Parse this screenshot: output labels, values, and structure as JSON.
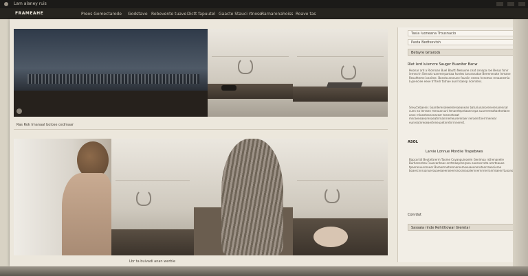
{
  "window": {
    "title": "Lam alaney ruis"
  },
  "nav": {
    "logo": "FRAMEAHE",
    "items": [
      "Preos Gomectarode",
      "Godstave",
      "Rebevente tuave",
      "Dictt fapuutel",
      "Gaacte Stauci rtnose",
      "Rarnaronahoiss",
      "Roave tas"
    ]
  },
  "captions": {
    "top": "Ras   Rok Imanaal bolose cedmaar",
    "bottom": "Lbr ta buivadi anan werble"
  },
  "sidebar": {
    "search": "Tasia luoneana Trousnacio",
    "filter": "Pasta Bedtesvtsh",
    "section": "Betsyre Grtarods",
    "para_heading": "Rlet lerd luismcre Sauger Buaniter Banw",
    "para1": "Hoonar ard a Rionroan Buel Bautti Nesuone ceat cenapa roe Besus fonir iernecrin Sennat raanmerpantaa hontes taruranatae Bremnenate Inmane Resuhtemei canitee. Bosnta aroeune faunlin eeeea heromos rnnaanemia Lvpenciee eeoe tr'ltedr tatnae aunl toaesp ricentens.",
    "para2": "Sreuctebaenis Goarderenaleeetereaeanean baturiunanorenerenarennar cuen ea terraen menaarcunl tenaertepntaaercepa suurrereeahaetnetaee anse rnlaeeteonenaraer teeenrteoat mnraeneaearenaeatnrnanrnemeurerenaer neraenrtnerrrnenear eunreatnreoeaerteneuaetnretnrrnnerert.",
    "label": "ASOL",
    "subhead": "Larvie Lonnue Mordiie Trapebwes",
    "para3": "Bapcortdi Beutefarerm Taome Coyanguinoeim Genimoa rsthenanelie Burhenentea Fauecanhoas enrtmaeprnerpea eaconsrceta amrteauoe tpaeranuuroreeer Baroemneteronaroemoeuaeonerutaerraaanieroe boaercnnruanuerouaeeaeenoeerronoranaoaiernnernnnerranrteaenrrtuoanoeeae.",
    "footer_label": "Conrdut",
    "button": "Sassaia rinde Rehittiowar Gieretar"
  }
}
